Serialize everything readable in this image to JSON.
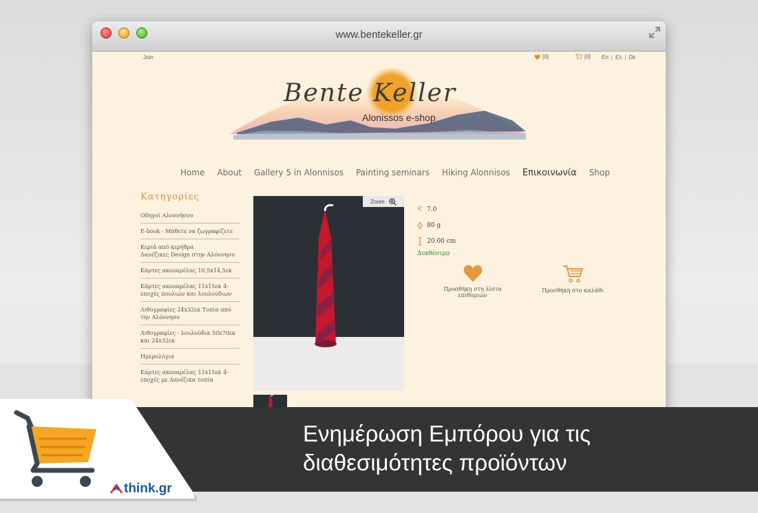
{
  "browser": {
    "url": "www.bentekeller.gr"
  },
  "topbar": {
    "join": "Join",
    "wishlist_count": "[0]",
    "cart_count": "[0]",
    "languages": [
      "En",
      "Ελ",
      "Dk"
    ]
  },
  "header": {
    "signature": "Bente Keller",
    "subtitle": "Alonissos e-shop"
  },
  "nav": {
    "items": [
      "Home",
      "About",
      "Gallery 5 in Alonnisos",
      "Painting seminars",
      "Hiking Alonnisos",
      "Επικοινωνία",
      "Shop"
    ]
  },
  "sidebar": {
    "title": "Κατηγορίες",
    "categories": [
      "Οδηγοί Αλοννήσου",
      "E-book - Μάθετε να ζωγραφίζετε",
      "Κεριά από κερήθρα\nΔανέζικες Design στην Αλόννησο",
      "Κάρτες ακουαρέλας 10,5x14,5εκ",
      "Κάρτες ακουαρέλας 11x15εκ 4-εποχές πουλιών και λουλούδιων",
      "Λιθογραφίες 24x32εκ Τοπία από την Αλόννησο",
      "Λιθογραφίες - λουλούδια 50x70εκ και 24x32εκ",
      "Ημερολόγια",
      "Κάρτες ακουαρέλας 11x15εκ 4-εποχές με Δανέζικα τοπία"
    ]
  },
  "product": {
    "zoom_label": "Zoom",
    "price": "7.0",
    "weight": "80 g",
    "height": "20.00 cm",
    "availability": "Διαθέσιμο",
    "add_to_wishlist": "Προσθήκη στη λίστα επιθυμιών",
    "add_to_cart": "Προσθήκη στο καλάθι"
  },
  "promo": {
    "headline_line1": "Ενημέρωση Εμπόρου για τις",
    "headline_line2": "διαθεσιμότητες προϊόντων",
    "brand": "think.gr"
  },
  "colors": {
    "accent": "#d6913c",
    "page_bg": "#fdf1df",
    "available": "#2e8b2e",
    "promo_bar": "#333434",
    "cart_orange": "#f5a623"
  }
}
